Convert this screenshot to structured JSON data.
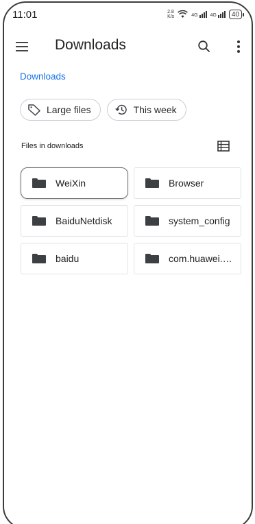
{
  "status_bar": {
    "time": "11:01",
    "net_speed_value": "2.8",
    "net_speed_unit": "K/s",
    "signal_1_label": "4G",
    "signal_2_label": "4G",
    "battery": "40",
    "wifi_icon": "wifi-icon"
  },
  "app_bar": {
    "title": "Downloads",
    "menu_icon": "hamburger-menu-icon",
    "search_icon": "search-icon",
    "more_icon": "more-vertical-icon"
  },
  "breadcrumb": "Downloads",
  "chips": [
    {
      "label": "Large files",
      "icon": "tag-icon"
    },
    {
      "label": "This week",
      "icon": "history-icon"
    }
  ],
  "section": {
    "label": "Files in downloads",
    "view_icon": "list-view-icon"
  },
  "folders": [
    {
      "name": "WeiXin",
      "selected": true
    },
    {
      "name": "Browser"
    },
    {
      "name": "BaiduNetdisk"
    },
    {
      "name": "system_config"
    },
    {
      "name": "baidu"
    },
    {
      "name": "com.huawei.…"
    }
  ],
  "colors": {
    "accent": "#1a73e8",
    "text": "#202124",
    "border": "#e0e2e5",
    "folder_icon": "#3c4043"
  }
}
